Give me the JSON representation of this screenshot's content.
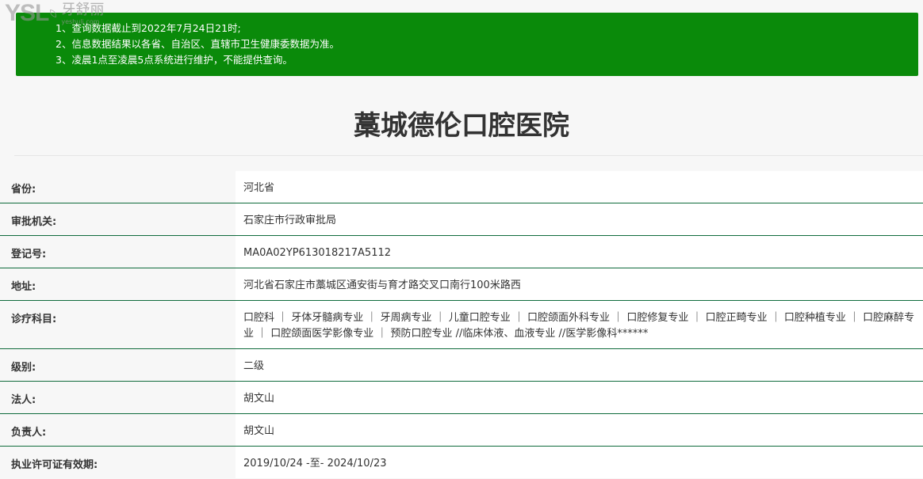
{
  "logo": {
    "mark": "YSL",
    "cn": "牙舒丽",
    "url": "yeshuli.com"
  },
  "notice": [
    "1、查询数据截止到2022年7月24日21时;",
    "2、信息数据结果以各省、自治区、直辖市卫生健康委数据为准。",
    "3、凌晨1点至凌晨5点系统进行维护，不能提供查询。"
  ],
  "title": "藁城德伦口腔医院",
  "rows": [
    {
      "label": "省份:",
      "value": "河北省"
    },
    {
      "label": "审批机关:",
      "value": "石家庄市行政审批局"
    },
    {
      "label": "登记号:",
      "value": "MA0A02YP613018217A5112"
    },
    {
      "label": "地址:",
      "value": "河北省石家庄市藁城区通安街与育才路交叉口南行100米路西"
    },
    {
      "label": "诊疗科目:",
      "value": "口腔科 ｜ 牙体牙髓病专业 ｜ 牙周病专业 ｜ 儿童口腔专业 ｜ 口腔颌面外科专业 ｜ 口腔修复专业 ｜ 口腔正畸专业 ｜ 口腔种植专业 ｜ 口腔麻醉专业 ｜ 口腔颌面医学影像专业 ｜ 预防口腔专业 //临床体液、血液专业 //医学影像科******"
    },
    {
      "label": "级别:",
      "value": "二级"
    },
    {
      "label": "法人:",
      "value": "胡文山"
    },
    {
      "label": "负责人:",
      "value": "胡文山"
    },
    {
      "label": "执业许可证有效期:",
      "value": "2019/10/24 -至- 2024/10/23"
    }
  ]
}
